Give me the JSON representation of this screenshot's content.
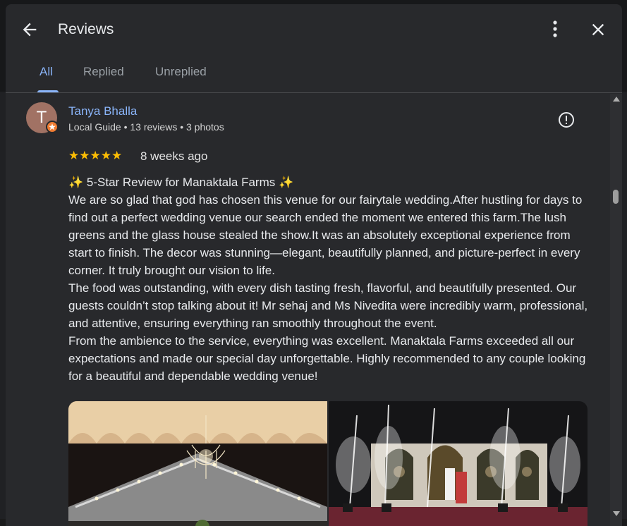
{
  "header": {
    "title": "Reviews",
    "back_icon": "arrow-left-icon",
    "more_icon": "more-vert-icon",
    "close_icon": "close-icon"
  },
  "tabs": [
    {
      "label": "All",
      "active": true
    },
    {
      "label": "Replied",
      "active": false
    },
    {
      "label": "Unreplied",
      "active": false
    }
  ],
  "review": {
    "avatar_initial": "T",
    "reviewer_name": "Tanya Bhalla",
    "reviewer_meta": "Local Guide • 13 reviews • 3 photos",
    "stars": "★★★★★",
    "rating": 5,
    "date": "8 weeks ago",
    "text_lines": [
      "✨ 5-Star Review for Manaktala Farms ✨",
      "We are so glad that god has chosen this venue for our fairytale wedding.After hustling for days to find out a perfect wedding venue our search ended the moment we entered this farm.The lush greens and the glass house stealed the show.It was an absolutely exceptional experience from start to finish. The decor was stunning—elegant, beautifully planned, and picture-perfect in every corner. It truly brought our vision to life.",
      "The food was outstanding, with every dish tasting fresh, flavorful, and beautifully presented. Our guests couldn’t stop talking about it! Mr sehaj and Ms Nivedita were incredibly warm, professional, and attentive, ensuring everything ran smoothly throughout the event.",
      "From the ambience to the service, everything was excellent. Manaktala Farms exceeded all our expectations and made our special day unforgettable. Highly recommended to any couple looking for a beautiful and dependable wedding venue!"
    ],
    "photos": [
      {
        "name": "wedding-venue-chandelier-photo"
      },
      {
        "name": "wedding-stage-fireworks-photo"
      }
    ]
  },
  "colors": {
    "accent": "#8ab4f8",
    "star": "#fbbc04",
    "badge": "#f07c32",
    "background": "#28292c"
  }
}
